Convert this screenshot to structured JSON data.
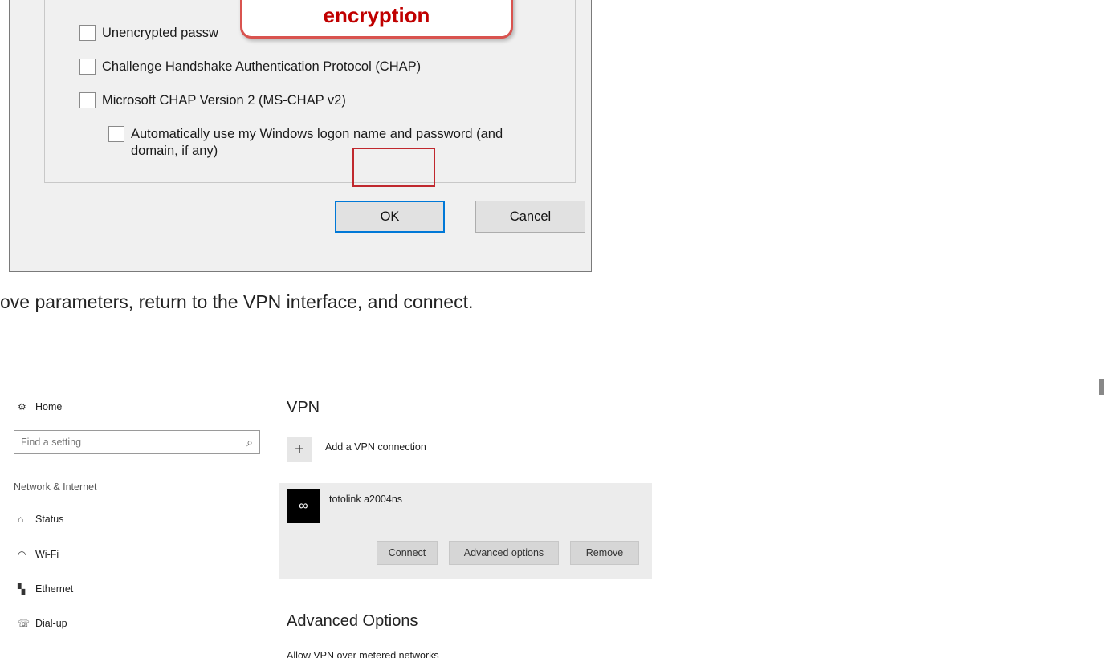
{
  "dialog": {
    "callout_text": "encryption",
    "options": {
      "unencrypted": "Unencrypted passw",
      "chap": "Challenge Handshake Authentication Protocol (CHAP)",
      "mschap": "Microsoft CHAP Version 2 (MS-CHAP v2)",
      "auto_logon": "Automatically use my Windows logon name and password (and domain, if any)"
    },
    "ok_label": "OK",
    "cancel_label": "Cancel"
  },
  "instruction_text": "ove parameters, return to the VPN interface, and connect.",
  "settings": {
    "sidebar": {
      "home_label": "Home",
      "search_placeholder": "Find a setting",
      "section_label": "Network & Internet",
      "items": [
        {
          "label": "Status",
          "icon": "status-icon"
        },
        {
          "label": "Wi-Fi",
          "icon": "wifi-icon"
        },
        {
          "label": "Ethernet",
          "icon": "ethernet-icon"
        },
        {
          "label": "Dial-up",
          "icon": "dialup-icon"
        }
      ]
    },
    "vpn": {
      "title": "VPN",
      "add_label": "Add a VPN connection",
      "connection_name": "totolink a2004ns",
      "connect_label": "Connect",
      "advanced_label": "Advanced options",
      "remove_label": "Remove"
    },
    "advanced": {
      "title": "Advanced Options",
      "metered_label": "Allow VPN over metered networks"
    }
  },
  "colors": {
    "callout_border": "#d9534f",
    "callout_text": "#c00000",
    "highlight_border": "#c0282e",
    "ok_border": "#0078d7"
  }
}
